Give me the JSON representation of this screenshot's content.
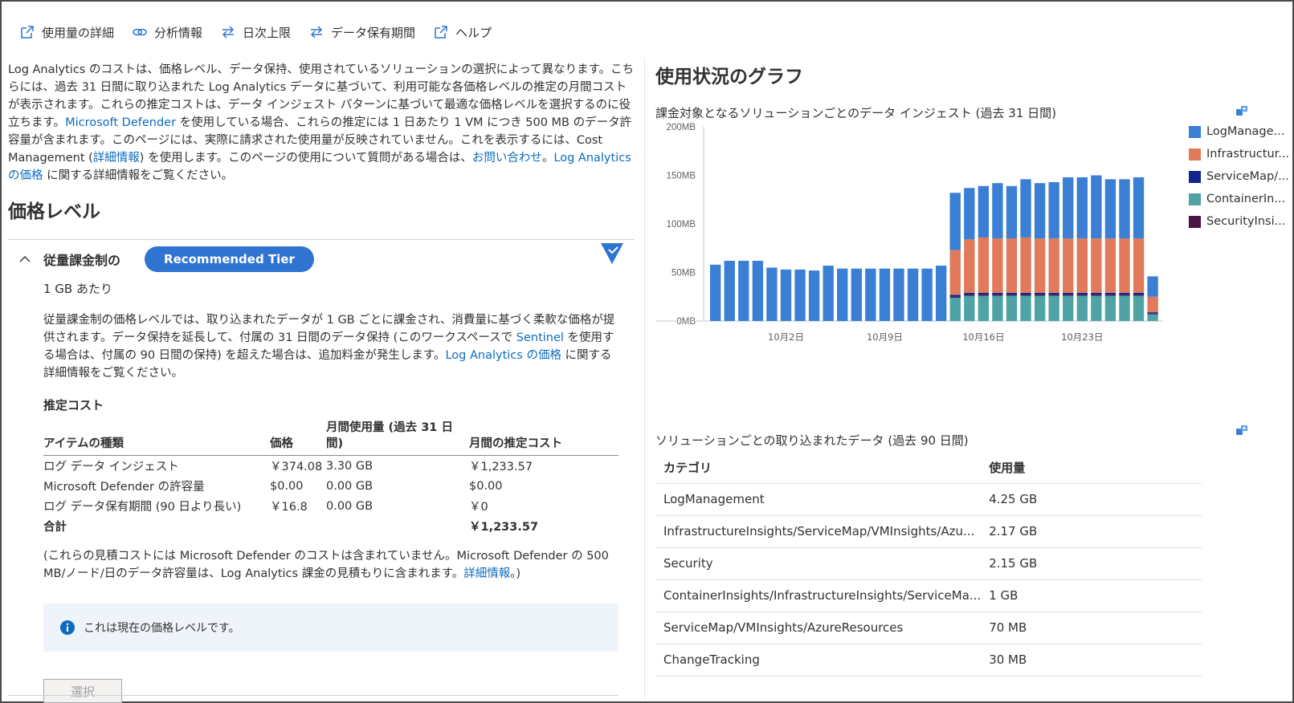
{
  "toolbar": {
    "items": [
      {
        "label": "使用量の詳細",
        "icon": "open-external-icon"
      },
      {
        "label": "分析情報",
        "icon": "link-icon"
      },
      {
        "label": "日次上限",
        "icon": "swap-arrows-icon"
      },
      {
        "label": "データ保有期間",
        "icon": "swap-arrows-icon"
      },
      {
        "label": "ヘルプ",
        "icon": "open-external-icon"
      }
    ]
  },
  "intro": {
    "p1": "Log Analytics のコストは、価格レベル、データ保持、使用されているソリューションの選択によって異なります。こちらには、過去 31 日間に取り込まれた Log Analytics データに基づいて、利用可能な各価格レベルの推定の月間コストが表示されます。これらの推定コストは、データ インジェスト パターンに基づいて最適な価格レベルを選択するのに役立ちます。",
    "link_defender": "Microsoft Defender",
    "p2": " を使用している場合、これらの推定には 1 日あたり 1 VM につき 500 MB のデータ許容量が含まれます。このページには、実際に請求された使用量が反映されていません。これを表示するには、Cost Management (",
    "link_details": "詳細情報",
    "p3": ") を使用します。このページの使用について質問がある場合は、",
    "link_contact": "お問い合わせ",
    "p4": "。",
    "link_pricing": "Log Analytics の価格",
    "p5": " に関する詳細情報をご覧ください。"
  },
  "pricing": {
    "heading": "価格レベル",
    "tier_name": "従量課金制の",
    "recommended": "Recommended Tier",
    "unit": "1 GB あたり",
    "desc1": "従量課金制の価格レベルでは、取り込まれたデータが 1 GB ごとに課金され、消費量に基づく柔軟な価格が提供されます。データ保持を延長して、付属の 31 日間のデータ保持 (このワークスペースで ",
    "desc_link_sentinel": "Sentinel",
    "desc2": " を使用する場合は、付属の 90 日間の保持) を超えた場合は、追加料金が発生します。",
    "desc_link_pricing": "Log Analytics の価格",
    "desc3": " に関する詳細情報をご覧ください。",
    "est_title": "推定コスト",
    "columns": [
      "アイテムの種類",
      "価格",
      "月間使用量 (過去 31 日間)",
      "月間の推定コスト"
    ],
    "rows": [
      [
        "ログ データ インジェスト",
        "￥374.08",
        "3.30 GB",
        "￥1,233.57"
      ],
      [
        "Microsoft Defender の許容量",
        "$0.00",
        "0.00 GB",
        "$0.00"
      ],
      [
        "ログ データ保有期間 (90 日より長い)",
        "￥16.8",
        "0.00 GB",
        "￥0"
      ]
    ],
    "total_label": "合計",
    "total_value": "￥1,233.57",
    "note1": "(これらの見積コストには Microsoft Defender のコストは含まれていません。Microsoft Defender の 500 MB/ノード/日のデータ許容量は、Log Analytics 課金の見積もりに含まれます。",
    "note_link": "詳細情報",
    "note2": "。)",
    "info_text": "これは現在の価格レベルです。",
    "select_label": "選択"
  },
  "usage": {
    "title": "使用状況のグラフ",
    "chart_subtitle": "課金対象となるソリューションごとのデータ インジェスト (過去 31 日間)",
    "table_subtitle": "ソリューションごとの取り込まれたデータ (過去 90 日間)",
    "table_columns": [
      "カテゴリ",
      "使用量"
    ],
    "table_rows": [
      [
        "LogManagement",
        "4.25 GB"
      ],
      [
        "InfrastructureInsights/ServiceMap/VMInsights/Azu...",
        "2.17 GB"
      ],
      [
        "Security",
        "2.15 GB"
      ],
      [
        "ContainerInsights/InfrastructureInsights/ServiceMa...",
        "1 GB"
      ],
      [
        "ServiceMap/VMInsights/AzureResources",
        "70 MB"
      ],
      [
        "ChangeTracking",
        "30 MB"
      ]
    ]
  },
  "colors": {
    "log": "#3a7fd4",
    "infra": "#e07a5a",
    "servicemap": "#13238f",
    "container": "#4fa3a5",
    "security": "#4a1346",
    "accent": "#2f74d0"
  },
  "chart_data": {
    "type": "bar",
    "stacked": true,
    "title": "",
    "y_ticks": [
      "200MB",
      "150MB",
      "100MB",
      "50MB",
      "0MB"
    ],
    "x_ticks": [
      "10月2日",
      "10月9日",
      "10月16日",
      "10月23日"
    ],
    "ylim": [
      0,
      200
    ],
    "legend": [
      "LogManage...",
      "Infrastructur...",
      "ServiceMap/...",
      "ContainerIn...",
      "SecurityInsi..."
    ],
    "series": [
      {
        "key": "log",
        "values": [
          58,
          62,
          62,
          62,
          55,
          53,
          53,
          52,
          57,
          54,
          54,
          54,
          54,
          54,
          54,
          54,
          57,
          59,
          53,
          53,
          57,
          54,
          60,
          57,
          58,
          63,
          63,
          65,
          61,
          61,
          63,
          21
        ]
      },
      {
        "key": "infra",
        "values": [
          0,
          0,
          0,
          0,
          0,
          0,
          0,
          0,
          0,
          0,
          0,
          0,
          0,
          0,
          0,
          0,
          0,
          46,
          55,
          57,
          56,
          56,
          57,
          56,
          56,
          56,
          56,
          56,
          56,
          56,
          56,
          16
        ]
      },
      {
        "key": "servicemap",
        "values": [
          0,
          0,
          0,
          0,
          0,
          0,
          0,
          0,
          0,
          0,
          0,
          0,
          0,
          0,
          0,
          0,
          0,
          2,
          2,
          2,
          2,
          2,
          2,
          2,
          2,
          2,
          2,
          2,
          2,
          2,
          2,
          1
        ]
      },
      {
        "key": "container",
        "values": [
          0,
          0,
          0,
          0,
          0,
          0,
          0,
          0,
          0,
          0,
          0,
          0,
          0,
          0,
          0,
          0,
          0,
          24,
          26,
          26,
          26,
          26,
          26,
          26,
          26,
          26,
          26,
          26,
          26,
          26,
          26,
          7
        ]
      },
      {
        "key": "security",
        "values": [
          0,
          0,
          0,
          0,
          0,
          0,
          0,
          0,
          0,
          0,
          0,
          0,
          0,
          0,
          0,
          0,
          0,
          1,
          1,
          1,
          1,
          1,
          1,
          1,
          1,
          1,
          1,
          1,
          1,
          1,
          1,
          1
        ]
      }
    ]
  }
}
